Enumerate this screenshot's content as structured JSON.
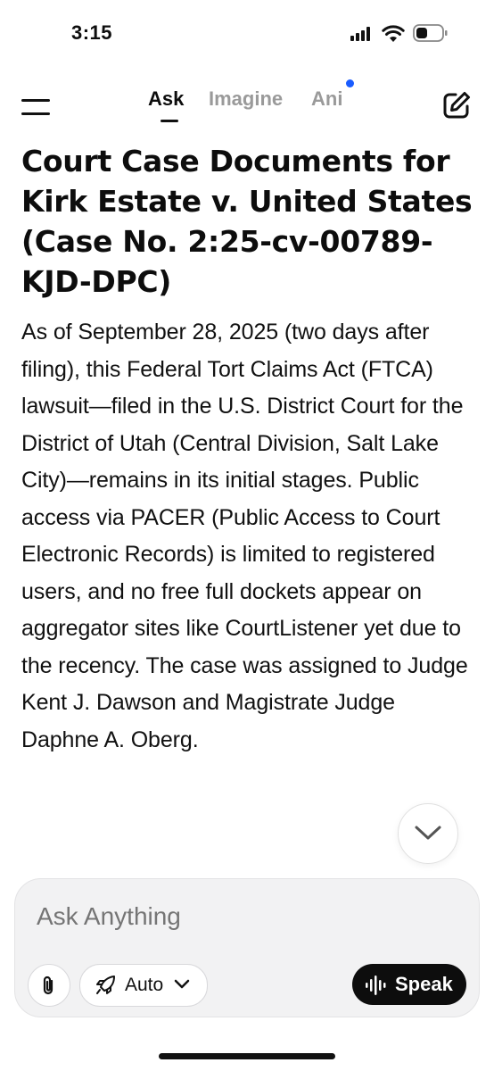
{
  "status_bar": {
    "time": "3:15"
  },
  "header": {
    "tabs": [
      {
        "label": "Ask",
        "active": true
      },
      {
        "label": "Imagine",
        "active": false
      },
      {
        "label": "Ani",
        "active": false,
        "has_notification_dot": true
      }
    ],
    "menu_icon": "hamburger-icon",
    "new_chat_icon": "edit-icon"
  },
  "message": {
    "title": "Court Case Documents for Kirk Estate v. United States (Case No. 2:25-cv-00789-KJD-DPC)",
    "body": "As of September 28, 2025 (two days after filing), this Federal Tort Claims Act (FTCA) lawsuit—filed in the U.S. District Court for the District of Utah (Central Division, Salt Lake City)—remains in its initial stages. Public access via PACER (Public Access to Court Electronic Records) is limited to registered users, and no free full dockets appear on aggregator sites like CourtListener yet due to the recency. The case was assigned to Judge Kent J. Dawson and Magistrate Judge Daphne A. Oberg."
  },
  "composer": {
    "placeholder": "Ask Anything",
    "mode_label": "Auto",
    "speak_label": "Speak"
  },
  "colors": {
    "accent_dot": "#1a5cff",
    "speak_button": "#0d0d0d"
  }
}
